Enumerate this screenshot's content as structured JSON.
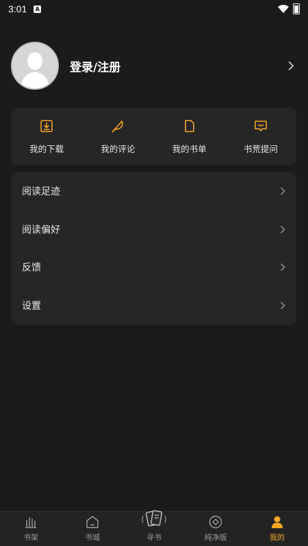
{
  "status_bar": {
    "time": "3:01",
    "notif": "A"
  },
  "profile": {
    "name": "登录/注册"
  },
  "quick_actions": [
    {
      "label": "我的下载",
      "icon": "download-icon"
    },
    {
      "label": "我的评论",
      "icon": "feather-icon"
    },
    {
      "label": "我的书单",
      "icon": "document-icon"
    },
    {
      "label": "书荒提问",
      "icon": "chat-icon"
    }
  ],
  "menu": [
    {
      "label": "阅读足迹"
    },
    {
      "label": "阅读偏好"
    },
    {
      "label": "反馈"
    },
    {
      "label": "设置"
    }
  ],
  "tabs": [
    {
      "label": "书架",
      "icon": "bookshelf-icon",
      "active": false
    },
    {
      "label": "书城",
      "icon": "bookstore-icon",
      "active": false
    },
    {
      "label": "寻书",
      "icon": "cards-icon",
      "active": false
    },
    {
      "label": "纯净版",
      "icon": "pure-icon",
      "active": false
    },
    {
      "label": "我的",
      "icon": "person-icon",
      "active": true
    }
  ],
  "colors": {
    "accent": "#f5a623",
    "background": "#1b1b1b",
    "card": "#262626"
  }
}
